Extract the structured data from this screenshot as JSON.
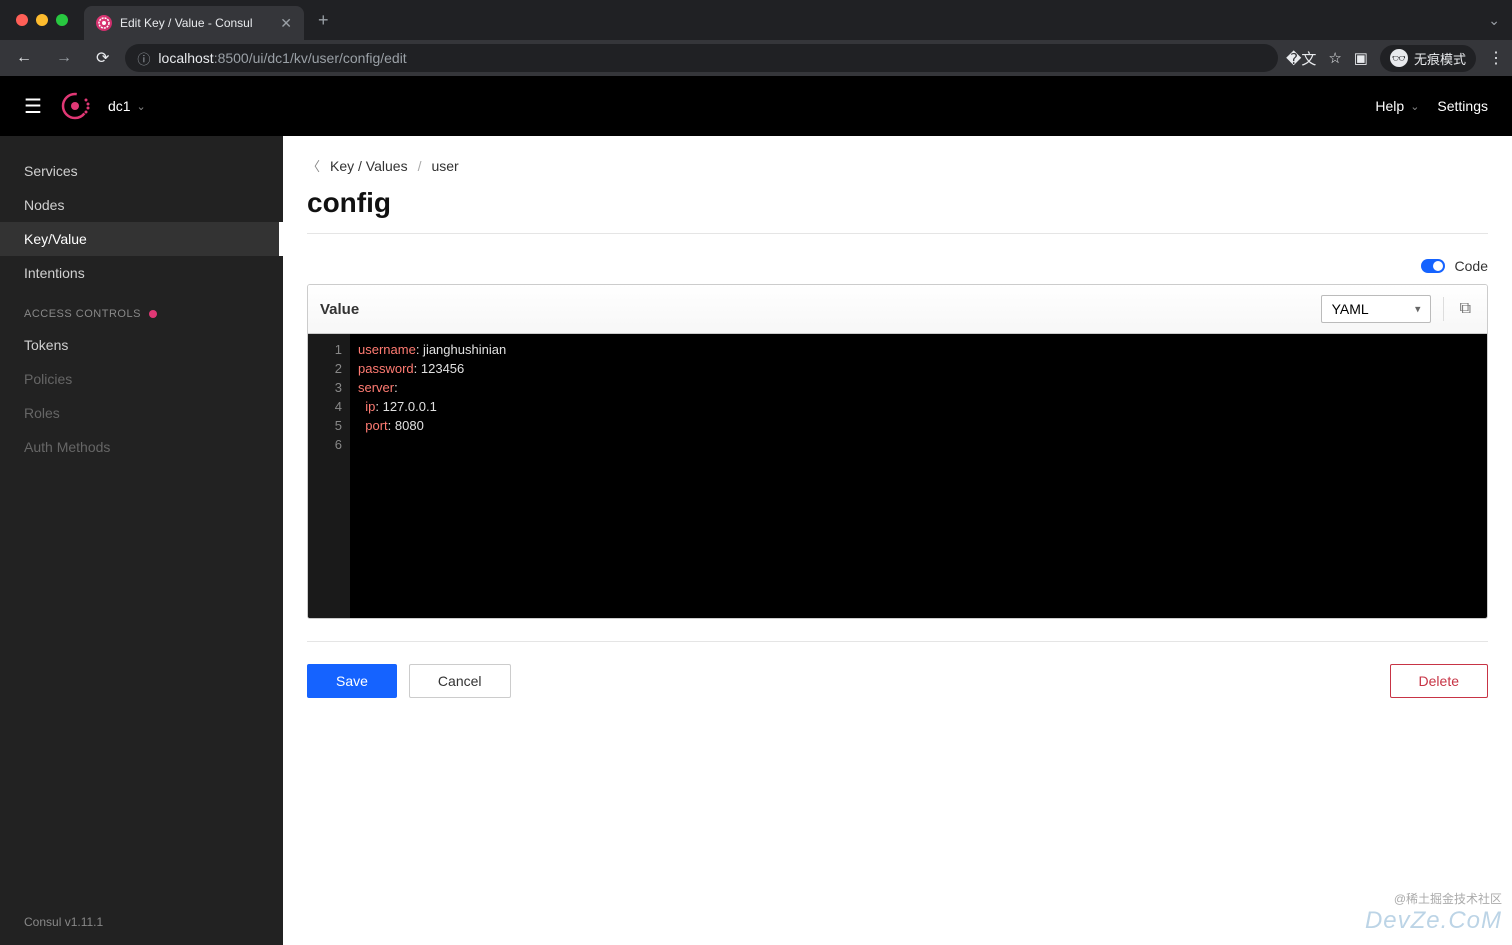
{
  "browser": {
    "tab_title": "Edit Key / Value - Consul",
    "url_host": "localhost",
    "url_path": ":8500/ui/dc1/kv/user/config/edit",
    "incognito_label": "无痕模式"
  },
  "header": {
    "dc_label": "dc1",
    "help_label": "Help",
    "settings_label": "Settings"
  },
  "sidebar": {
    "items": [
      {
        "label": "Services"
      },
      {
        "label": "Nodes"
      },
      {
        "label": "Key/Value"
      },
      {
        "label": "Intentions"
      }
    ],
    "section_label": "ACCESS CONTROLS",
    "controls_items": [
      {
        "label": "Tokens"
      },
      {
        "label": "Policies"
      },
      {
        "label": "Roles"
      },
      {
        "label": "Auth Methods"
      }
    ],
    "footer": "Consul v1.11.1"
  },
  "breadcrumbs": {
    "root": "Key / Values",
    "parent": "user"
  },
  "page": {
    "title": "config",
    "code_toggle_label": "Code",
    "editor_label": "Value",
    "format_selected": "YAML"
  },
  "code": {
    "lines": [
      {
        "n": "1",
        "key": "username",
        "punc": ":",
        "val": " jianghushinian",
        "indent": ""
      },
      {
        "n": "2",
        "key": "password",
        "punc": ":",
        "val": " 123456",
        "indent": ""
      },
      {
        "n": "3",
        "key": "server",
        "punc": ":",
        "val": "",
        "indent": ""
      },
      {
        "n": "4",
        "key": "ip",
        "punc": ":",
        "val": " 127.0.0.1",
        "indent": "  "
      },
      {
        "n": "5",
        "key": "port",
        "punc": ":",
        "val": " 8080",
        "indent": "  "
      },
      {
        "n": "6",
        "key": "",
        "punc": "",
        "val": "",
        "indent": ""
      }
    ]
  },
  "buttons": {
    "save": "Save",
    "cancel": "Cancel",
    "delete": "Delete"
  },
  "watermark": {
    "line1": "@稀土掘金技术社区",
    "line2": "DevZe.CoM"
  }
}
